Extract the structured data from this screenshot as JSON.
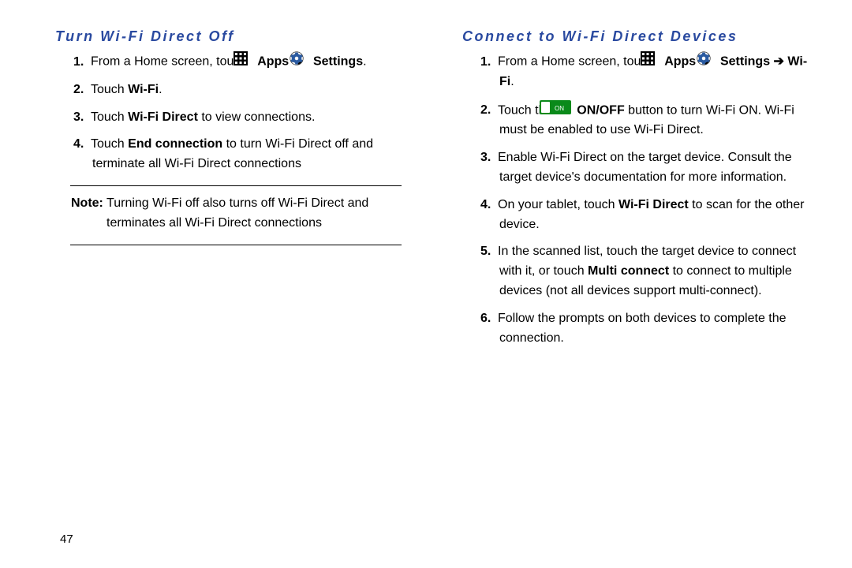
{
  "page_number": "47",
  "left": {
    "heading": "Turn Wi-Fi Direct Off",
    "steps": [
      {
        "n": "1.",
        "pre": "From a Home screen, touch ",
        "bold1": "Apps",
        "mid": " ",
        "bold2": "Settings",
        "post": "."
      },
      {
        "n": "2.",
        "pre": "Touch ",
        "bold1": "Wi-Fi",
        "post": "."
      },
      {
        "n": "3.",
        "pre": "Touch ",
        "bold1": "Wi-Fi Direct",
        "post": " to view connections."
      },
      {
        "n": "4.",
        "pre": "Touch ",
        "bold1": "End connection",
        "post": " to turn Wi-Fi Direct off and terminate all Wi-Fi Direct connections"
      }
    ],
    "note_label": "Note:",
    "note_text": " Turning Wi-Fi off also turns off Wi-Fi Direct and terminates all Wi-Fi Direct connections"
  },
  "right": {
    "heading": "Connect to Wi-Fi Direct Devices",
    "steps": [
      {
        "n": "1.",
        "pre": "From a Home screen, touch ",
        "bold1": "Apps",
        "mid": " ",
        "bold2": "Settings",
        "bold3": "Wi-Fi",
        "post": "."
      },
      {
        "n": "2.",
        "pre": "Touch the ",
        "bold1": "ON/OFF",
        "post": " button to turn Wi-Fi ON. Wi-Fi must be enabled to use Wi-Fi Direct."
      },
      {
        "n": "3.",
        "pre": "Enable Wi-Fi Direct on the target device. Consult the target device's documentation for more information."
      },
      {
        "n": "4.",
        "pre": "On your tablet, touch ",
        "bold1": "Wi-Fi Direct",
        "post": " to scan for the other device."
      },
      {
        "n": "5.",
        "pre": "In the scanned list, touch the target device to connect with it, or touch ",
        "bold1": "Multi connect",
        "post": " to connect to multiple devices (not all devices support multi-connect)."
      },
      {
        "n": "6.",
        "pre": "Follow the prompts on both devices to complete the connection."
      }
    ]
  },
  "arrow_glyph": "➔",
  "on_label": "ON"
}
